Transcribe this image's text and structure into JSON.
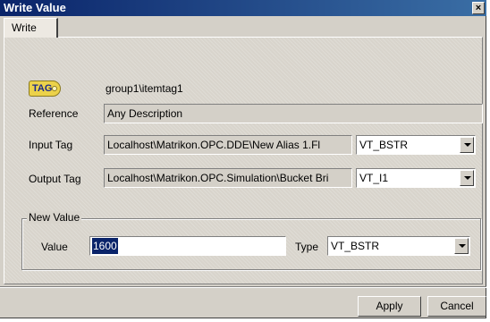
{
  "window": {
    "title": "Write Value",
    "close_label": "×"
  },
  "tabs": [
    {
      "label": "Write"
    }
  ],
  "tag_icon": {
    "text": "TAG",
    "icon": "tag-icon"
  },
  "item": {
    "name": "group1\\itemtag1"
  },
  "reference": {
    "label": "Reference",
    "value": "Any Description"
  },
  "input_tag": {
    "label": "Input Tag",
    "value": "Localhost\\Matrikon.OPC.DDE\\New Alias 1.Fl",
    "type": "VT_BSTR"
  },
  "output_tag": {
    "label": "Output Tag",
    "value": "Localhost\\Matrikon.OPC.Simulation\\Bucket Bri",
    "type": "VT_I1"
  },
  "new_value": {
    "group_label": "New Value",
    "value_label": "Value",
    "value": "1600",
    "type_label": "Type",
    "type": "VT_BSTR"
  },
  "buttons": {
    "apply": "Apply",
    "cancel": "Cancel"
  }
}
